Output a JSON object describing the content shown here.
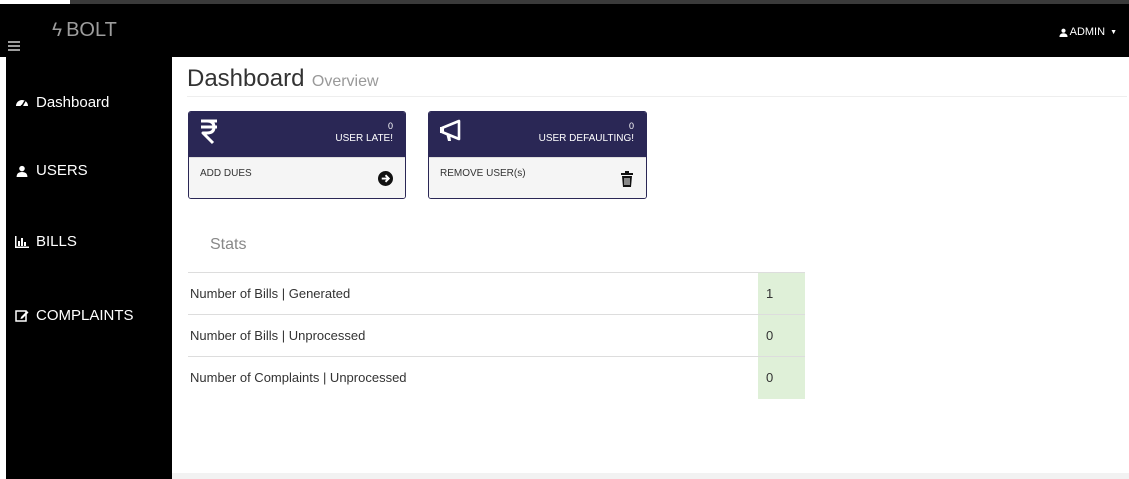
{
  "navbar": {
    "brand": "BOLT",
    "user": "ADMIN"
  },
  "sidebar": {
    "items": [
      {
        "label": "Dashboard",
        "icon": "dashboard-icon"
      },
      {
        "label": "USERS",
        "icon": "user-icon"
      },
      {
        "label": "BILLS",
        "icon": "bar-chart-icon"
      },
      {
        "label": "COMPLAINTS",
        "icon": "edit-icon"
      }
    ]
  },
  "header": {
    "title": "Dashboard",
    "subtitle": "Overview"
  },
  "panels": [
    {
      "count": "0",
      "label": "USER LATE!",
      "footer": "ADD DUES",
      "head_icon": "rupee-icon",
      "foot_icon": "arrow-circle-right-icon"
    },
    {
      "count": "0",
      "label": "USER DEFAULTING!",
      "footer": "REMOVE USER(s)",
      "head_icon": "bullhorn-icon",
      "foot_icon": "trash-icon"
    }
  ],
  "stats": {
    "title": "Stats",
    "rows": [
      {
        "name": "Number of Bills | Generated",
        "value": "1"
      },
      {
        "name": "Number of Bills | Unprocessed",
        "value": "0"
      },
      {
        "name": "Number of Complaints | Unprocessed",
        "value": "0"
      }
    ]
  },
  "colors": {
    "panel_header": "#2a2755",
    "stat_value_bg": "#dff0d8",
    "sidebar_bg": "#000000"
  }
}
